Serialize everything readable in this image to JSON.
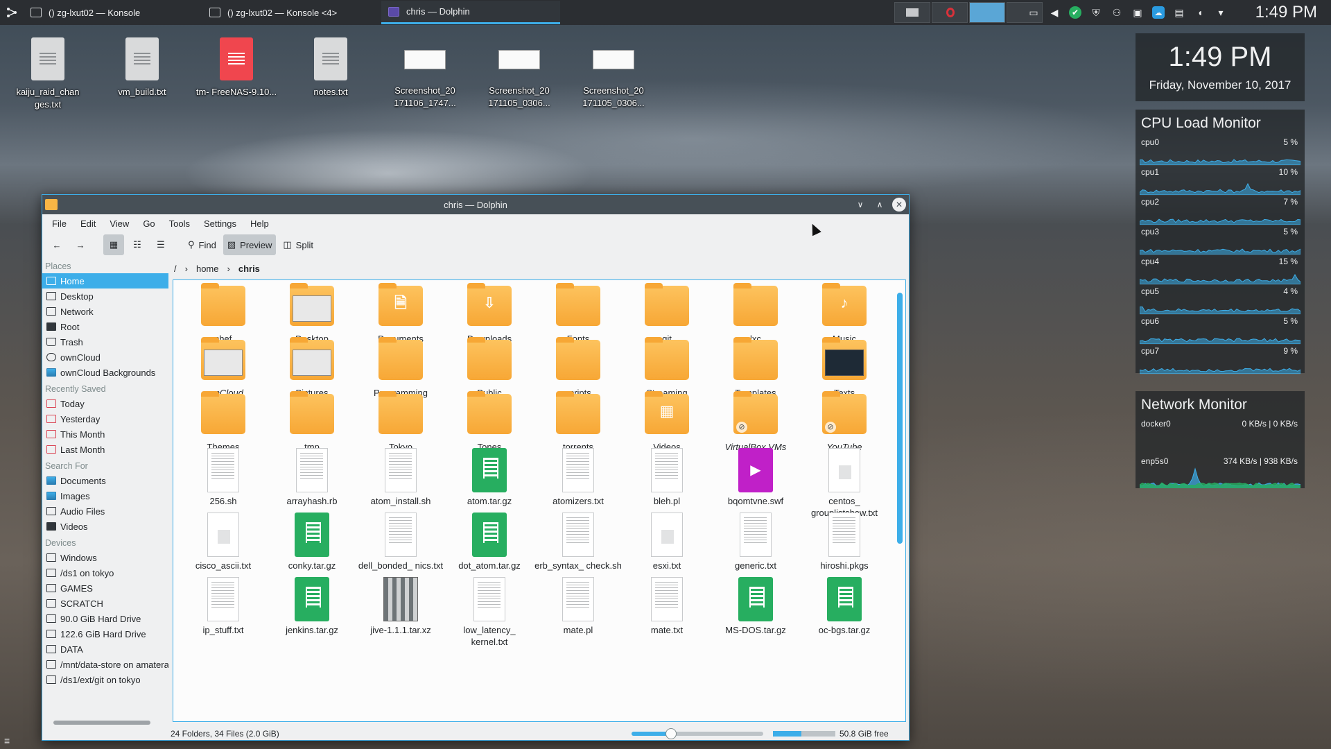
{
  "panel": {
    "tasks": [
      {
        "label": "() zg-lxut02 — Konsole",
        "active": false
      },
      {
        "label": "() zg-lxut02 — Konsole <4>",
        "active": false
      },
      {
        "label": "chris — Dolphin",
        "active": true
      }
    ],
    "clock": "1:49 PM"
  },
  "desktop_icons": [
    {
      "label": "kaiju_raid_chan ges.txt",
      "kind": "text"
    },
    {
      "label": "vm_build.txt",
      "kind": "text"
    },
    {
      "label": "tm- FreeNAS-9.10...",
      "kind": "red"
    },
    {
      "label": "notes.txt",
      "kind": "text"
    },
    {
      "label": "Screenshot_20 171106_1747...",
      "kind": "shot"
    },
    {
      "label": "Screenshot_20 171105_0306...",
      "kind": "shot"
    },
    {
      "label": "Screenshot_20 171105_0306...",
      "kind": "shot"
    }
  ],
  "clock_widget": {
    "time": "1:49 PM",
    "date": "Friday, November 10, 2017"
  },
  "cpu_monitor": {
    "title": "CPU Load Monitor",
    "cpus": [
      {
        "name": "cpu0",
        "value": "5 %"
      },
      {
        "name": "cpu1",
        "value": "10 %"
      },
      {
        "name": "cpu2",
        "value": "7 %"
      },
      {
        "name": "cpu3",
        "value": "5 %"
      },
      {
        "name": "cpu4",
        "value": "15 %"
      },
      {
        "name": "cpu5",
        "value": "4 %"
      },
      {
        "name": "cpu6",
        "value": "5 %"
      },
      {
        "name": "cpu7",
        "value": "9 %"
      }
    ]
  },
  "network_monitor": {
    "title": "Network Monitor",
    "interfaces": [
      {
        "name": "docker0",
        "value": "0 KB/s | 0 KB/s"
      },
      {
        "name": "enp5s0",
        "value": "374 KB/s | 938 KB/s"
      }
    ]
  },
  "window": {
    "title": "chris — Dolphin",
    "menu": [
      "File",
      "Edit",
      "View",
      "Go",
      "Tools",
      "Settings",
      "Help"
    ],
    "toolbar": {
      "find": "Find",
      "preview": "Preview",
      "split": "Split"
    },
    "breadcrumb": {
      "root": "/",
      "home": "home",
      "current": "chris"
    },
    "places": {
      "sections": [
        {
          "title": "Places",
          "items": [
            "Home",
            "Desktop",
            "Network",
            "Root",
            "Trash",
            "ownCloud",
            "ownCloud Backgrounds"
          ]
        },
        {
          "title": "Recently Saved",
          "items": [
            "Today",
            "Yesterday",
            "This Month",
            "Last Month"
          ]
        },
        {
          "title": "Search For",
          "items": [
            "Documents",
            "Images",
            "Audio Files",
            "Videos"
          ]
        },
        {
          "title": "Devices",
          "items": [
            "Windows",
            "/ds1 on tokyo",
            "GAMES",
            "SCRATCH",
            "90.0 GiB Hard Drive",
            "122.6 GiB Hard Drive",
            "DATA",
            "/mnt/data-store on amatera",
            "/ds1/ext/git on tokyo"
          ]
        }
      ]
    },
    "items": [
      {
        "name": "chef",
        "type": "folder"
      },
      {
        "name": "Desktop",
        "type": "folder-thumbs"
      },
      {
        "name": "Documents",
        "type": "folder",
        "sym": "🗎"
      },
      {
        "name": "Downloads",
        "type": "folder",
        "sym": "⇩"
      },
      {
        "name": "Fonts",
        "type": "folder"
      },
      {
        "name": "git",
        "type": "folder"
      },
      {
        "name": "lxc",
        "type": "folder"
      },
      {
        "name": "Music",
        "type": "folder",
        "sym": "♪"
      },
      {
        "name": "ownCloud",
        "type": "folder-thumbs",
        "style": "it"
      },
      {
        "name": "Pictures",
        "type": "folder-thumbs"
      },
      {
        "name": "Programming",
        "type": "folder"
      },
      {
        "name": "Public",
        "type": "folder"
      },
      {
        "name": "scripts",
        "type": "folder"
      },
      {
        "name": "Streaming",
        "type": "folder"
      },
      {
        "name": "Templates",
        "type": "folder"
      },
      {
        "name": "Texts",
        "type": "folder-dark",
        "style": "ul"
      },
      {
        "name": "Themes",
        "type": "folder"
      },
      {
        "name": "tmp",
        "type": "folder"
      },
      {
        "name": "Tokyo",
        "type": "folder"
      },
      {
        "name": "Tones",
        "type": "folder"
      },
      {
        "name": "torrents",
        "type": "folder"
      },
      {
        "name": "Videos",
        "type": "folder",
        "sym": "▦"
      },
      {
        "name": "VirtualBox VMs",
        "type": "folder-link",
        "style": "it"
      },
      {
        "name": "YouTube",
        "type": "folder-link",
        "style": "it"
      },
      {
        "name": "256.sh",
        "type": "doc"
      },
      {
        "name": "arrayhash.rb",
        "type": "doc"
      },
      {
        "name": "atom_install.sh",
        "type": "doc"
      },
      {
        "name": "atom.tar.gz",
        "type": "gz"
      },
      {
        "name": "atomizers.txt",
        "type": "doc"
      },
      {
        "name": "bleh.pl",
        "type": "doc"
      },
      {
        "name": "bqomtvne.swf",
        "type": "swf"
      },
      {
        "name": "centos_ grouplistshow.txt",
        "type": "doc-plain"
      },
      {
        "name": "cisco_ascii.txt",
        "type": "doc-plain"
      },
      {
        "name": "conky.tar.gz",
        "type": "gz"
      },
      {
        "name": "dell_bonded_ nics.txt",
        "type": "doc"
      },
      {
        "name": "dot_atom.tar.gz",
        "type": "gz"
      },
      {
        "name": "erb_syntax_ check.sh",
        "type": "doc"
      },
      {
        "name": "esxi.txt",
        "type": "doc-plain"
      },
      {
        "name": "generic.txt",
        "type": "doc"
      },
      {
        "name": "hiroshi.pkgs",
        "type": "doc"
      },
      {
        "name": "ip_stuff.txt",
        "type": "doc"
      },
      {
        "name": "jenkins.tar.gz",
        "type": "gz"
      },
      {
        "name": "jive-1.1.1.tar.xz",
        "type": "xz"
      },
      {
        "name": "low_latency_ kernel.txt",
        "type": "doc"
      },
      {
        "name": "mate.pl",
        "type": "doc"
      },
      {
        "name": "mate.txt",
        "type": "doc"
      },
      {
        "name": "MS-DOS.tar.gz",
        "type": "gz"
      },
      {
        "name": "oc-bgs.tar.gz",
        "type": "gz"
      }
    ],
    "status": {
      "summary": "24 Folders, 34 Files (2.0 GiB)",
      "free_space": "50.8 GiB free",
      "zoom_fraction": 0.3,
      "disk_used_fraction": 0.45
    }
  },
  "colors": {
    "accent": "#3daee9",
    "folder": "#f7a735",
    "archive": "#27ae60",
    "panel": "#2b2e32"
  }
}
